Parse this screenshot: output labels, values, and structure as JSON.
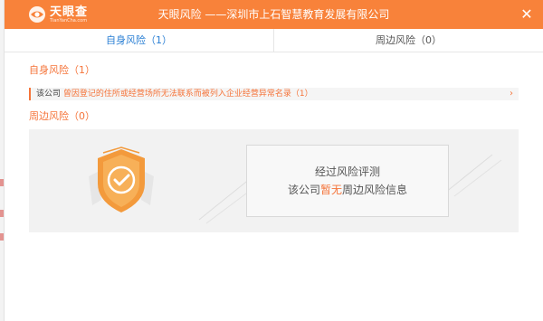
{
  "logo": {
    "name": "天眼查",
    "subtext": "TianYanCha.com"
  },
  "header": {
    "title": "天眼风险 ——深圳市上石智慧教育发展有限公司",
    "close_icon": "close-icon"
  },
  "tabs": [
    {
      "label": "自身风险（1）",
      "active": true
    },
    {
      "label": "周边风险（0）",
      "active": false
    }
  ],
  "self_risk": {
    "title": "自身风险（1）",
    "items": [
      {
        "prefix": "该公司",
        "text": "曾因登记的住所或经营场所无法联系而被列入企业经营异常名录（1）",
        "arrow": "›"
      }
    ]
  },
  "surrounding_risk": {
    "title": "周边风险（0）",
    "empty_line1": "经过风险评测",
    "empty_line2_prefix": "该公司",
    "empty_line2_highlight": "暂无",
    "empty_line2_suffix": "周边风险信息"
  },
  "colors": {
    "accent": "#f8823a",
    "risk_text": "#f5743a",
    "tab_active": "#2a7fd4"
  }
}
